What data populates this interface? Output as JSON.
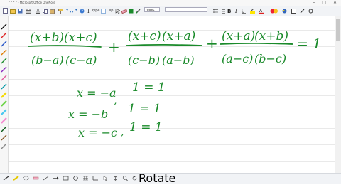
{
  "window": {
    "title": "° ° ° ° - Microsoft Office OneNote",
    "minimize": "–",
    "maximize": "□",
    "close": "✕"
  },
  "toolbar": {
    "type_label": "Type",
    "clip_label": "Clip",
    "zoom_value": "100%"
  },
  "statusbar": {
    "rotate_label": "Rotate"
  },
  "equation": {
    "term1": {
      "num_a": "(x+b)",
      "num_b": "(x+c)",
      "den_a": "(b−a)",
      "den_b": "(c−a)"
    },
    "plus1": "+",
    "term2": {
      "num_a": "(x+c)",
      "num_b": "(x+a)",
      "den_a": "(c−b)",
      "den_b": "(a−b)"
    },
    "plus2": "+",
    "term3": {
      "num_a": "(x+a)",
      "num_b": "(x+b)",
      "den_a": "(a−c)",
      "den_b": "(b−c)"
    },
    "equals": "= 1"
  },
  "solutions": [
    {
      "x": "x = −a",
      "comma": "",
      "result": "1 = 1"
    },
    {
      "x": "x = −b",
      "comma": ",",
      "result": "1 = 1"
    },
    {
      "x": "x = −c",
      "comma": ",",
      "result": "1 = 1"
    }
  ],
  "colors": {
    "ink": "#1a8a2a",
    "toolbar": "#f1f3f6"
  }
}
